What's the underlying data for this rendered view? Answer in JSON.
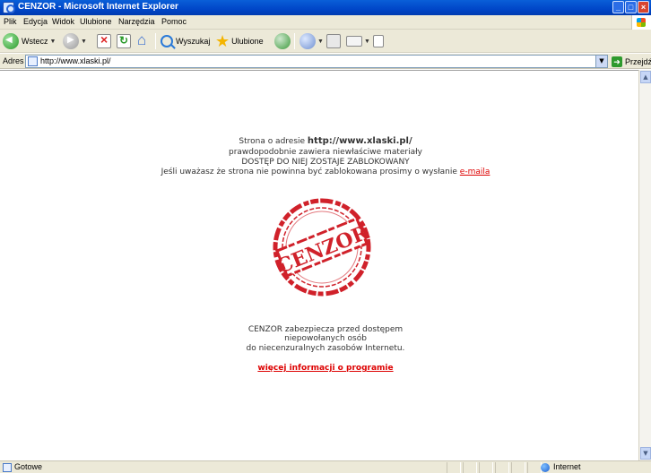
{
  "window": {
    "title": "CENZOR - Microsoft Internet Explorer",
    "controls": [
      "_",
      "□",
      "×"
    ]
  },
  "menu": {
    "items": [
      "Plik",
      "Edycja",
      "Widok",
      "Ulubione",
      "Narzędzia",
      "Pomoc"
    ]
  },
  "toolbar": {
    "back_label": "Wstecz",
    "search_label": "Wyszukaj",
    "favorites_label": "Ulubione"
  },
  "address": {
    "label": "Adres",
    "url": "http://www.xlaski.pl/",
    "go_label": "Przejdź"
  },
  "page": {
    "line1_prefix": "Strona o adresie ",
    "line1_url": "http://www.xlaski.pl/",
    "line2": "prawdopodobnie zawiera niewłaściwe materiały",
    "line3": "DOSTĘP DO NIEJ ZOSTAJE ZABLOKOWANY",
    "line4_prefix": "Jeśli uważasz że strona nie powinna być zablokowana prosimy o wysłanie ",
    "line4_link": "e-maila",
    "stamp_text": "CENZOR",
    "stamp_color": "#d0212a",
    "info_line1": "CENZOR zabezpiecza przed dostępem",
    "info_line2": "niepowołanych osób",
    "info_line3": "do niecenzuralnych zasobów Internetu.",
    "more_link": "więcej informacji o programie"
  },
  "status": {
    "text": "Gotowe",
    "zone": "Internet"
  }
}
